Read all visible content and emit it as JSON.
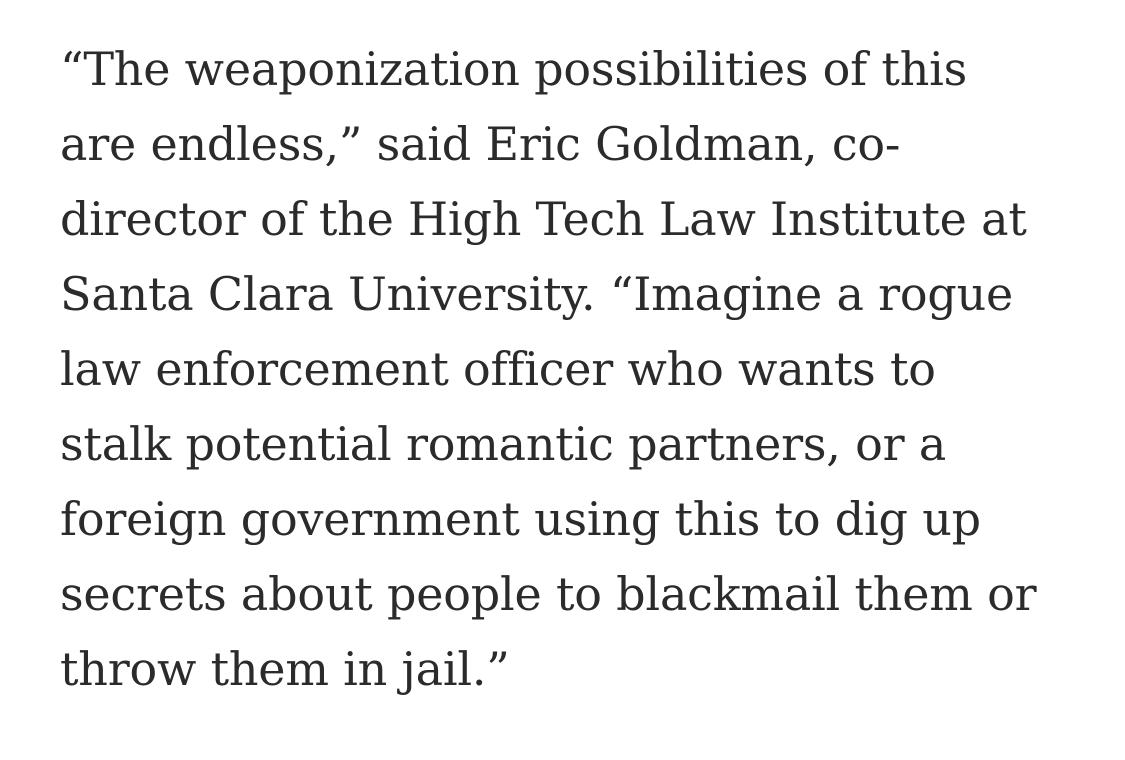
{
  "article": {
    "paragraph_lines": [
      "“The weaponization possibilities of this",
      "are endless,” said Eric Goldman, co-",
      "director of the High Tech Law Institute at",
      "Santa Clara University. “Imagine a rogue",
      "law enforcement officer who wants to",
      "stalk potential romantic partners, or a",
      "foreign government using this to dig up",
      "secrets about people to blackmail them or",
      "throw them in jail.”"
    ]
  },
  "colors": {
    "text": "#2b2b2b",
    "background": "#ffffff"
  }
}
